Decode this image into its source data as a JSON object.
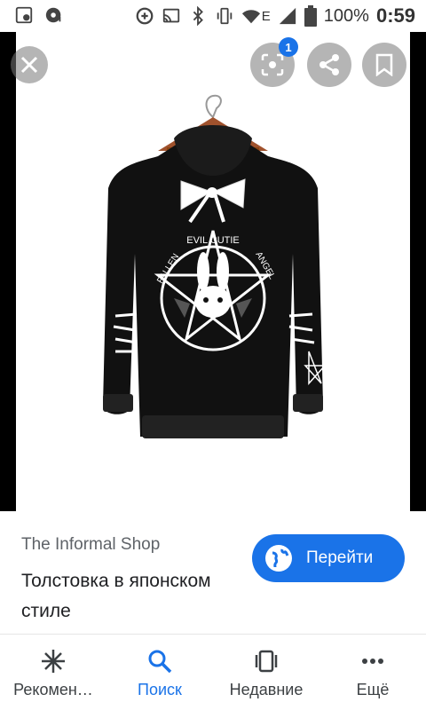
{
  "status_bar": {
    "left_icons": [
      "screen-record-icon",
      "music-icon"
    ],
    "right_icons": [
      "data-saver-icon",
      "cast-icon",
      "bluetooth-icon",
      "vibrate-icon",
      "wifi-icon",
      "signal-icon",
      "battery-icon"
    ],
    "network_label": "E",
    "battery": "100%",
    "time": "0:59"
  },
  "viewer": {
    "lens_badge": "1",
    "buttons": [
      "close-icon",
      "lens-icon",
      "share-icon",
      "bookmark-icon"
    ],
    "print_text": [
      "EVIL CUTIE",
      "FALLEN",
      "ANGEL"
    ]
  },
  "result": {
    "source": "The Informal Shop",
    "title": "Толстовка в японском стиле",
    "visit_label": "Перейти"
  },
  "nav": {
    "items": [
      {
        "label": "Рекомен…",
        "icon": "asterisk-icon"
      },
      {
        "label": "Поиск",
        "icon": "search-icon"
      },
      {
        "label": "Недавние",
        "icon": "recent-icon"
      },
      {
        "label": "Ещё",
        "icon": "more-icon"
      }
    ],
    "active_color": "#1a73e8"
  }
}
